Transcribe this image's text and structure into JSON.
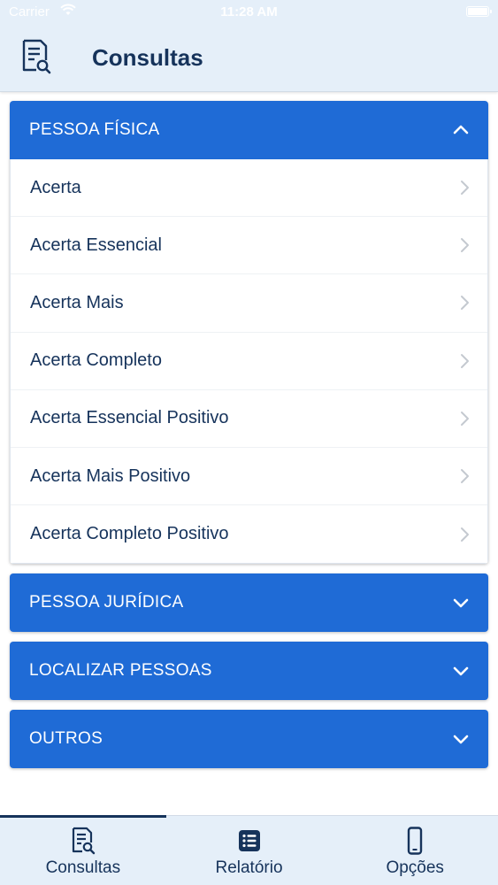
{
  "status_bar": {
    "carrier": "Carrier",
    "time": "11:28 AM"
  },
  "header": {
    "title": "Consultas",
    "icon": "document-search-icon"
  },
  "accordion": [
    {
      "title": "PESSOA FÍSICA",
      "expanded": true,
      "items": [
        "Acerta",
        "Acerta Essencial",
        "Acerta Mais",
        "Acerta Completo",
        "Acerta Essencial Positivo",
        "Acerta Mais Positivo",
        "Acerta Completo Positivo"
      ]
    },
    {
      "title": "PESSOA JURÍDICA",
      "expanded": false,
      "items": []
    },
    {
      "title": "LOCALIZAR PESSOAS",
      "expanded": false,
      "items": []
    },
    {
      "title": "OUTROS",
      "expanded": false,
      "items": []
    }
  ],
  "tabbar": {
    "tabs": [
      {
        "label": "Consultas",
        "icon": "document-search-icon",
        "active": true
      },
      {
        "label": "Relatório",
        "icon": "list-icon",
        "active": false
      },
      {
        "label": "Opções",
        "icon": "phone-icon",
        "active": false
      }
    ]
  },
  "colors": {
    "primary": "#1f6bd6",
    "text": "#16335b",
    "header_bg": "#e5eff9"
  }
}
